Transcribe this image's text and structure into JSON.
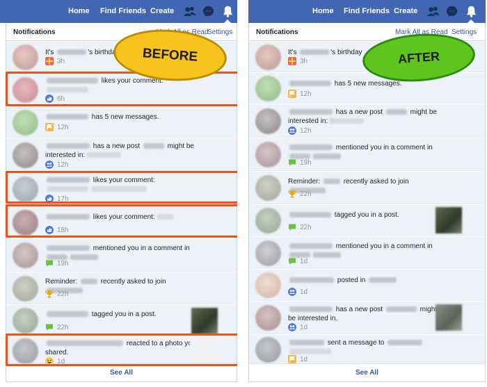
{
  "nav": {
    "home": "Home",
    "find_friends": "Find Friends",
    "create": "Create"
  },
  "nav_icons": [
    "friends-icon",
    "messenger-icon",
    "bell-icon"
  ],
  "before": {
    "header": {
      "title": "Notifications",
      "mark_read": "Mark All as Read",
      "settings": "Settings"
    },
    "label": "BEFORE",
    "label_color": "#f7c31c",
    "items": [
      {
        "prefix": "It's",
        "mid": "'s birthday",
        "time": "3h",
        "icon": "gift-icon"
      },
      {
        "mid": "likes your comment:",
        "time": "6h",
        "icon": "like-icon"
      },
      {
        "mid": "has 5 new messages.",
        "time": "12h",
        "icon": "flag-icon"
      },
      {
        "mid": "has a new post",
        "mid2": "might be interested in:",
        "time": "12h",
        "icon": "group-icon"
      },
      {
        "mid": "likes your comment:",
        "time": "17h",
        "icon": "like-icon"
      },
      {
        "mid": "likes your comment:",
        "time": "18h",
        "icon": "like-icon"
      },
      {
        "mid": "mentioned you in a comment in",
        "time": "19h",
        "icon": "comment-icon"
      },
      {
        "prefix": "Reminder:",
        "mid": "recently asked to join",
        "time": "22h",
        "icon": "trophy-icon"
      },
      {
        "mid": "tagged you in a post.",
        "time": "22h",
        "icon": "comment-icon"
      },
      {
        "mid": "reacted to a photo",
        "mid2": "you shared.",
        "time": "1d",
        "icon": "haha-icon"
      }
    ],
    "see_all": "See All"
  },
  "after": {
    "header": {
      "title": "Notifications",
      "mark_read": "Mark All as Read",
      "settings": "Settings"
    },
    "label": "AFTER",
    "label_color": "#5ec41e",
    "items": [
      {
        "prefix": "It's",
        "mid": "'s birthday",
        "time": "3h",
        "icon": "gift-icon"
      },
      {
        "mid": "has 5 new messages.",
        "time": "12h",
        "icon": "flag-icon"
      },
      {
        "mid": "has a new post",
        "mid2": "might be interested in:",
        "time": "12h",
        "icon": "group-icon"
      },
      {
        "mid": "mentioned you in a comment in",
        "time": "19h",
        "icon": "comment-icon"
      },
      {
        "prefix": "Reminder:",
        "mid": "recently asked to join",
        "time": "22h",
        "icon": "trophy-icon"
      },
      {
        "mid": "tagged you in a post.",
        "time": "22h",
        "icon": "comment-icon"
      },
      {
        "mid": "mentioned you in a comment in",
        "time": "1d",
        "icon": "comment-icon"
      },
      {
        "mid": "posted in",
        "time": "1d",
        "icon": "group-icon"
      },
      {
        "mid": "has a new post",
        "mid2": "might be interested in.",
        "time": "1d",
        "icon": "group-icon"
      },
      {
        "mid": "sent a message to",
        "time": "1d",
        "icon": "flag-icon"
      }
    ],
    "see_all": "See All"
  },
  "colors": {
    "topbar": "#4267b2",
    "link": "#365899",
    "highlight_box": "#e8541c",
    "unread_bg": "#edf2fa"
  }
}
